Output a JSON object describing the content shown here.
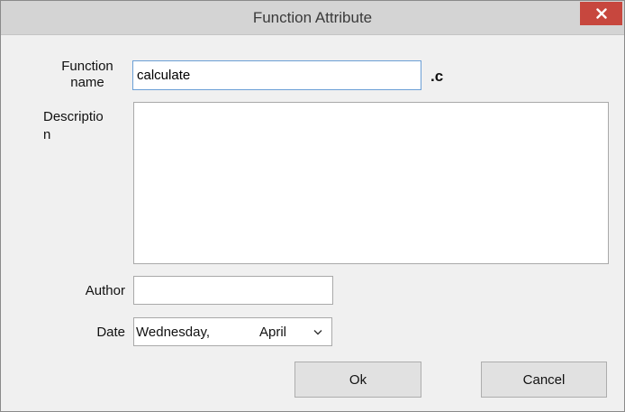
{
  "window": {
    "title": "Function Attribute",
    "close_glyph": "×"
  },
  "form": {
    "function_name_label_line1": "Function",
    "function_name_label_line2": "name",
    "function_name_value": "calculate",
    "extension": ".c",
    "description_label_line1": "Descriptio",
    "description_label_line2": "n",
    "description_value": "",
    "author_label": "Author",
    "author_value": "",
    "date_label": "Date",
    "date_weekday": "Wednesday,",
    "date_month": "April"
  },
  "buttons": {
    "ok_label": "Ok",
    "cancel_label": "Cancel"
  },
  "icons": {
    "close": "close-icon",
    "dropdown": "chevron-down-icon"
  },
  "colors": {
    "titlebar": "#d4d4d4",
    "close_button": "#c7473e",
    "dialog_bg": "#f0f0f0",
    "focus_border": "#6b9fd6"
  }
}
